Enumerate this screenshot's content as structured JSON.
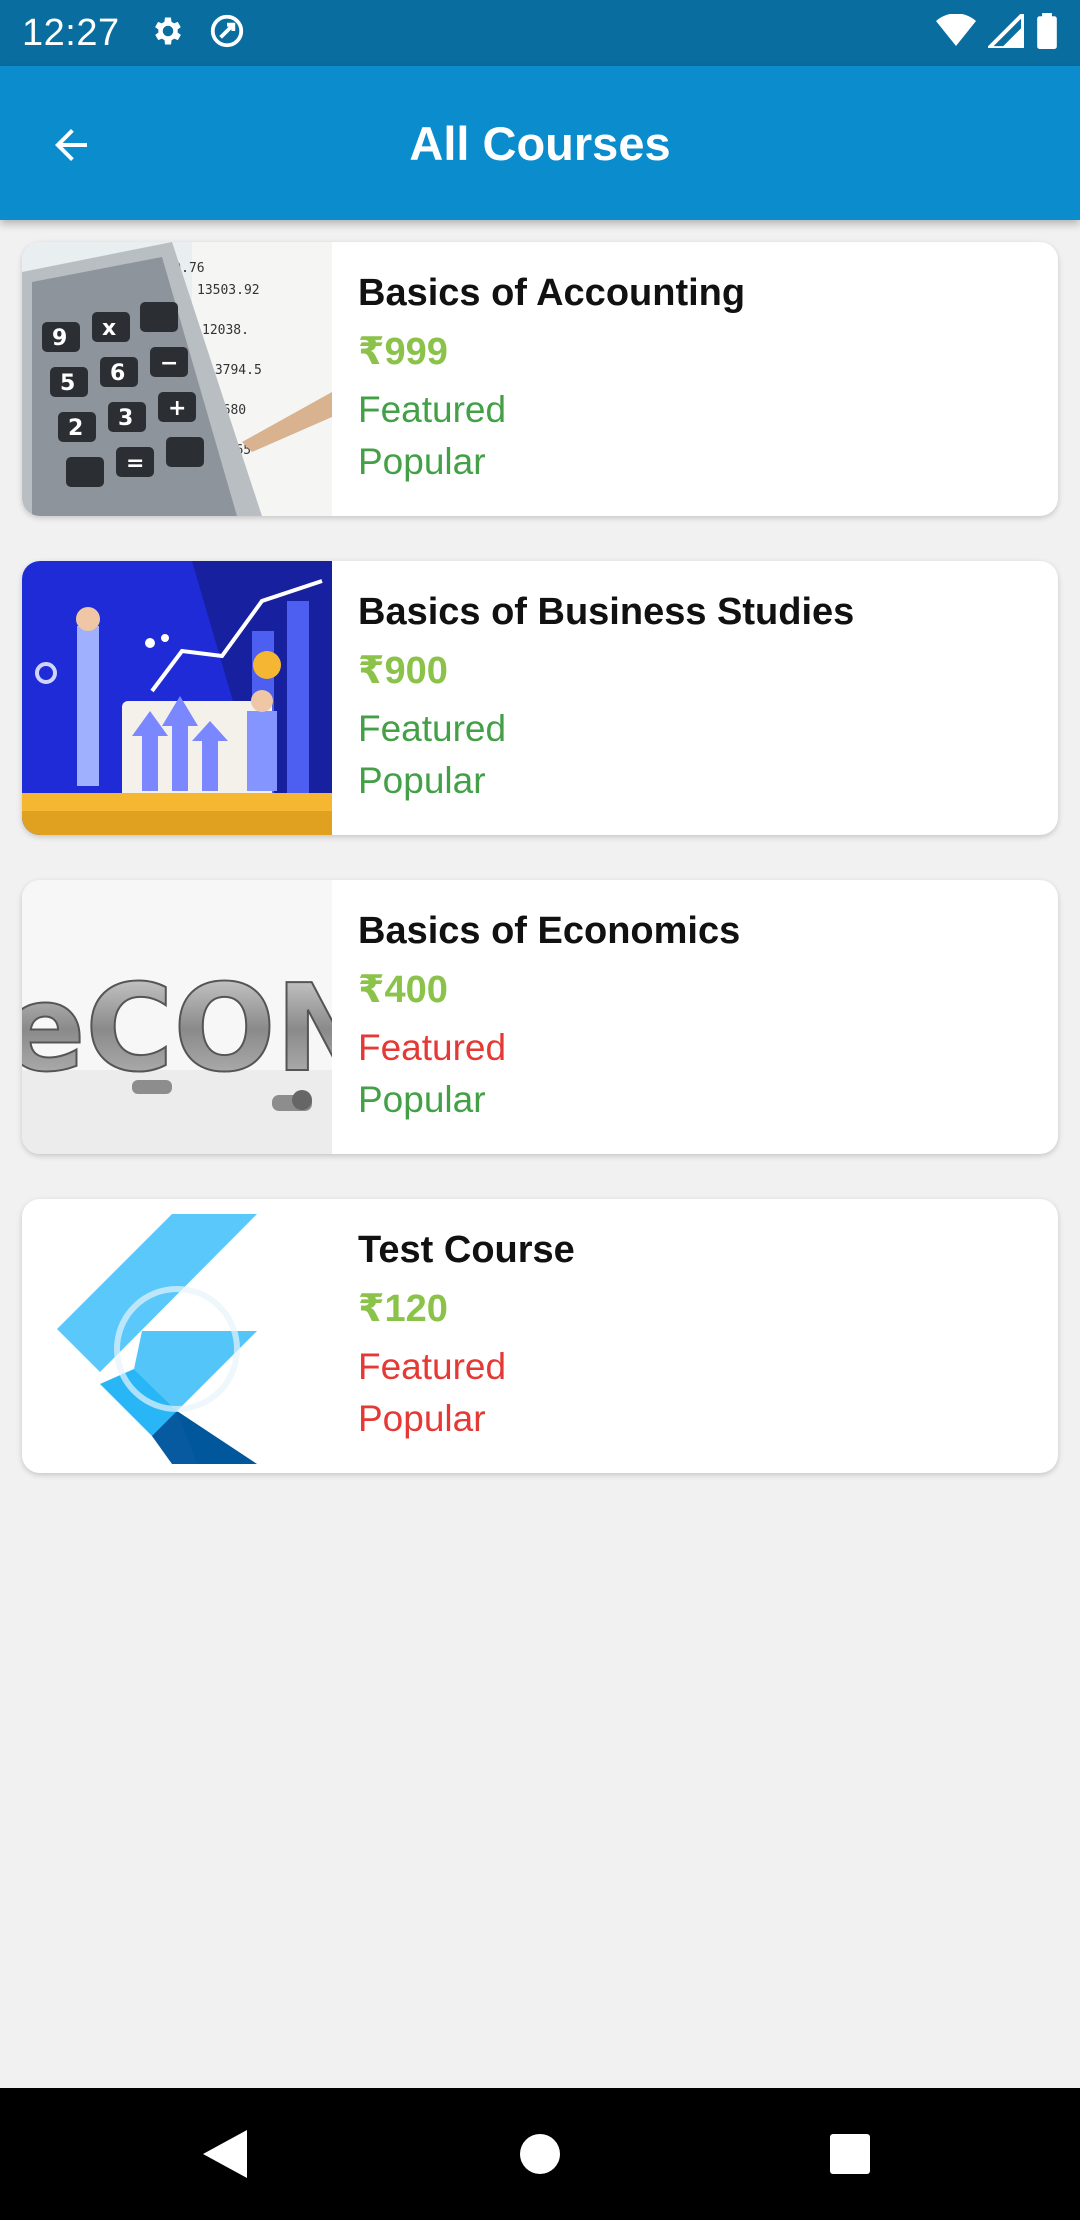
{
  "status_bar": {
    "time": "12:27",
    "icons_left": [
      "settings-icon",
      "at-sign-icon"
    ],
    "icons_right": [
      "wifi-icon",
      "signal-icon",
      "battery-icon"
    ]
  },
  "app_bar": {
    "back_icon": "arrow-left-icon",
    "title": "All Courses",
    "color": "#0b8ccc"
  },
  "courses": [
    {
      "title": "Basics of Accounting",
      "price": "₹999",
      "featured": "Featured",
      "popular": "Popular",
      "featured_on": true,
      "popular_on": true,
      "thumbnail": "calculator-image"
    },
    {
      "title": "Basics of Business Studies",
      "price": "₹900",
      "featured": "Featured",
      "popular": "Popular",
      "featured_on": true,
      "popular_on": true,
      "thumbnail": "business-illustration-image"
    },
    {
      "title": "Basics of Economics",
      "price": "₹400",
      "featured": "Featured",
      "popular": "Popular",
      "featured_on": false,
      "popular_on": true,
      "thumbnail": "economics-text-image"
    },
    {
      "title": "Test Course",
      "price": "₹120",
      "featured": "Featured",
      "popular": "Popular",
      "featured_on": false,
      "popular_on": false,
      "thumbnail": "flutter-logo-image"
    }
  ],
  "colors": {
    "price": "#8bc34a",
    "tag_on": "#43a047",
    "tag_off": "#e53935"
  },
  "nav_bar": {
    "icons": [
      "back-triangle-icon",
      "home-circle-icon",
      "recents-square-icon"
    ]
  }
}
